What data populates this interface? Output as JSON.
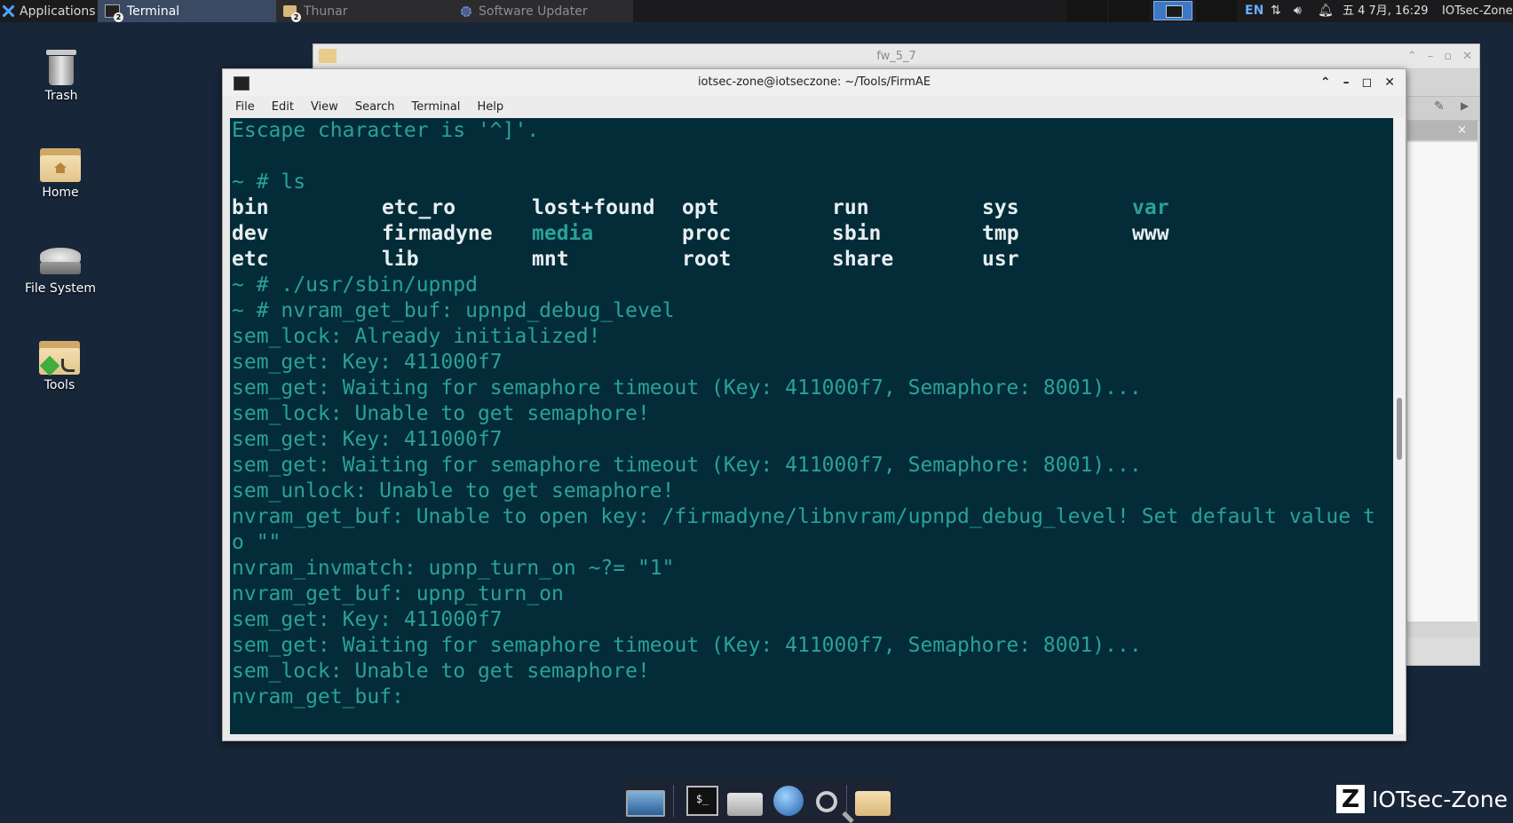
{
  "top_panel": {
    "applications_label": "Applications :",
    "tasks": [
      {
        "label": "Terminal",
        "badge": "2",
        "icon": "terminal-icon",
        "active": true
      },
      {
        "label": "Thunar",
        "badge": "2",
        "icon": "folder-icon",
        "active": false
      },
      {
        "label": "Software Updater",
        "icon": "updater-icon",
        "active": false
      }
    ],
    "language": "EN",
    "clock": "五 4 7月, 16:29",
    "user": "IOTsec-Zone"
  },
  "desktop": {
    "icons": [
      {
        "label": "Trash",
        "icon": "trash-icon"
      },
      {
        "label": "Home",
        "icon": "home-folder-icon"
      },
      {
        "label": "File System",
        "icon": "drive-icon"
      },
      {
        "label": "Tools",
        "icon": "tools-folder-icon"
      }
    ]
  },
  "background_window": {
    "title": "fw_5_7",
    "side_close": "×"
  },
  "terminal": {
    "title": "iotsec-zone@iotseczone: ~/Tools/FirmAE",
    "menu": [
      "File",
      "Edit",
      "View",
      "Search",
      "Terminal",
      "Help"
    ],
    "lines_before": [
      "Escape character is '^]'.",
      "",
      "~ # ls"
    ],
    "ls_rows": [
      [
        {
          "t": "bin",
          "d": false
        },
        {
          "t": "etc_ro",
          "d": false
        },
        {
          "t": "lost+found",
          "d": false
        },
        {
          "t": "opt",
          "d": false
        },
        {
          "t": "run",
          "d": false
        },
        {
          "t": "sys",
          "d": false
        },
        {
          "t": "var",
          "d": true
        }
      ],
      [
        {
          "t": "dev",
          "d": false
        },
        {
          "t": "firmadyne",
          "d": false
        },
        {
          "t": "media",
          "d": true
        },
        {
          "t": "proc",
          "d": false
        },
        {
          "t": "sbin",
          "d": false
        },
        {
          "t": "tmp",
          "d": false
        },
        {
          "t": "www",
          "d": false
        }
      ],
      [
        {
          "t": "etc",
          "d": false
        },
        {
          "t": "lib",
          "d": false
        },
        {
          "t": "mnt",
          "d": false
        },
        {
          "t": "root",
          "d": false
        },
        {
          "t": "share",
          "d": false
        },
        {
          "t": "usr",
          "d": false
        },
        {
          "t": "",
          "d": false
        }
      ]
    ],
    "lines_after": [
      "~ # ./usr/sbin/upnpd",
      "~ # nvram_get_buf: upnpd_debug_level",
      "sem_lock: Already initialized!",
      "sem_get: Key: 411000f7",
      "sem_get: Waiting for semaphore timeout (Key: 411000f7, Semaphore: 8001)...",
      "sem_lock: Unable to get semaphore!",
      "sem_get: Key: 411000f7",
      "sem_get: Waiting for semaphore timeout (Key: 411000f7, Semaphore: 8001)...",
      "sem_unlock: Unable to get semaphore!",
      "nvram_get_buf: Unable to open key: /firmadyne/libnvram/upnpd_debug_level! Set default value t",
      "o \"\"",
      "nvram_invmatch: upnp_turn_on ~?= \"1\"",
      "nvram_get_buf: upnp_turn_on",
      "sem_get: Key: 411000f7",
      "sem_get: Waiting for semaphore timeout (Key: 411000f7, Semaphore: 8001)...",
      "sem_lock: Unable to get semaphore!",
      "nvram_get_buf:"
    ]
  },
  "dock": {
    "items": [
      "desktop-icon",
      "terminal-icon",
      "home-icon",
      "browser-icon",
      "search-icon",
      "folder-icon"
    ],
    "terminal_glyph": "$_"
  },
  "watermark": {
    "logo_letter": "Z",
    "text": "IOTsec-Zone"
  },
  "colors": {
    "terminal_bg": "#032c38",
    "terminal_fg": "#2aa198",
    "ls_file": "#e8eef0",
    "desktop_bg": "#172638",
    "panel_bg": "#1b1b1d"
  }
}
